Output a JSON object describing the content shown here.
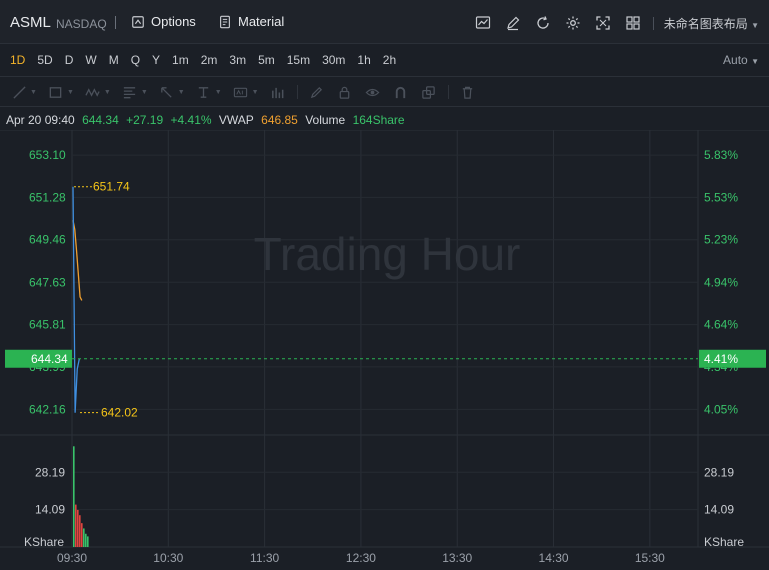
{
  "header": {
    "symbol": "ASML",
    "exchange": "NASDAQ",
    "options_label": "Options",
    "material_label": "Material",
    "layout_name": "未命名图表布局"
  },
  "periods": {
    "items": [
      "1D",
      "5D",
      "D",
      "W",
      "M",
      "Q",
      "Y",
      "1m",
      "2m",
      "3m",
      "5m",
      "15m",
      "30m",
      "1h",
      "2h"
    ],
    "active": "1D",
    "auto_label": "Auto"
  },
  "info": {
    "datetime": "Apr 20 09:40",
    "price": "644.34",
    "change": "+27.19",
    "change_pct": "+4.41%",
    "vwap_label": "VWAP",
    "vwap_value": "646.85",
    "volume_label": "Volume",
    "volume_value": "164Share"
  },
  "colors": {
    "green": "#39c36a",
    "red": "#e0453f",
    "orange": "#f0a030",
    "yellow": "#f5c518",
    "blue": "#3f8fe0",
    "current_badge": "#2bb352"
  },
  "chart_data": {
    "type": "line",
    "watermark": "Trading Hour",
    "x_ticks": [
      "09:30",
      "10:30",
      "11:30",
      "12:30",
      "13:30",
      "14:30",
      "15:30"
    ],
    "x_range": [
      "09:30",
      "16:00"
    ],
    "price_ticks": [
      "653.10",
      "651.28",
      "649.46",
      "647.63",
      "645.81",
      "643.99",
      "642.16"
    ],
    "pct_ticks": [
      "5.83%",
      "5.53%",
      "5.23%",
      "4.94%",
      "4.64%",
      "4.34%",
      "4.05%"
    ],
    "ylim": [
      641.06,
      654.18
    ],
    "current_price": "644.34",
    "current_pct": "4.41%",
    "high_label": "651.74",
    "low_label": "642.02",
    "high_value": 651.74,
    "low_value": 642.02,
    "price_series": {
      "name": "Price",
      "points": [
        [
          0,
          651.74
        ],
        [
          1,
          642.02
        ],
        [
          2,
          643.9
        ],
        [
          3,
          644.34
        ]
      ]
    },
    "vwap_series": {
      "name": "VWAP",
      "points": [
        [
          0,
          650.3
        ],
        [
          1,
          649.9
        ],
        [
          2,
          649.0
        ],
        [
          3,
          648.0
        ],
        [
          4,
          647.0
        ],
        [
          5,
          646.85
        ]
      ]
    },
    "volume_ticks": [
      "28.19",
      "14.09"
    ],
    "volume_axis_label": "KShare",
    "volume_max": 40,
    "volume_bars": [
      {
        "v": 38,
        "dir": "up"
      },
      {
        "v": 16,
        "dir": "down"
      },
      {
        "v": 14,
        "dir": "down"
      },
      {
        "v": 12,
        "dir": "down"
      },
      {
        "v": 9,
        "dir": "down"
      },
      {
        "v": 7,
        "dir": "up"
      },
      {
        "v": 5,
        "dir": "up"
      },
      {
        "v": 4,
        "dir": "up"
      }
    ]
  }
}
